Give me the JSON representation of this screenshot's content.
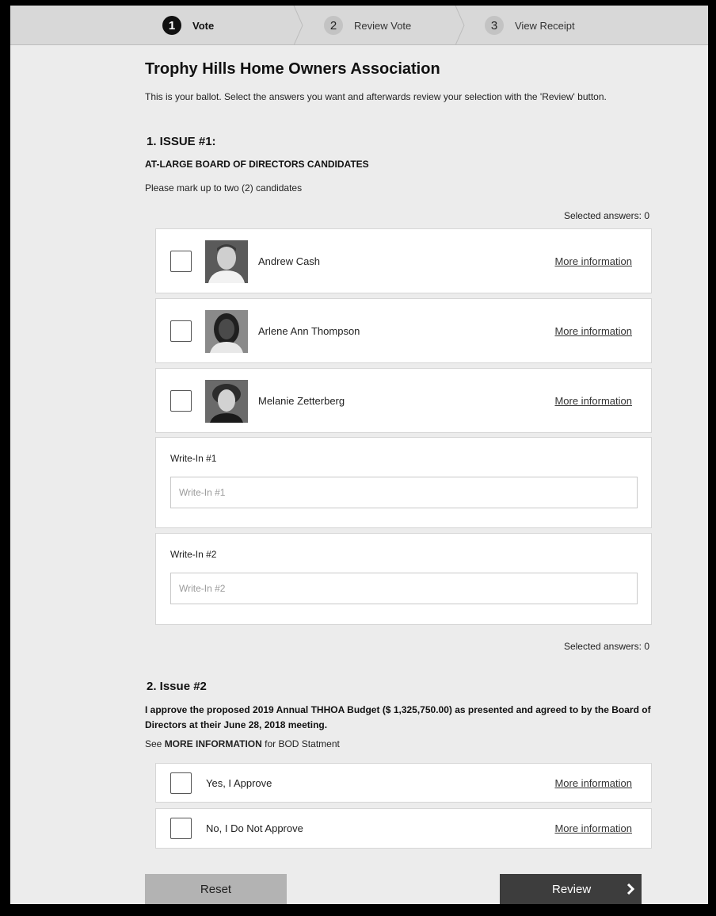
{
  "stepper": [
    {
      "num": "1",
      "label": "Vote"
    },
    {
      "num": "2",
      "label": "Review Vote"
    },
    {
      "num": "3",
      "label": "View Receipt"
    }
  ],
  "ballot": {
    "title": "Trophy Hills Home Owners Association",
    "intro": "This is your ballot. Select the answers you want and afterwards review your selection with the 'Review' button."
  },
  "issue1": {
    "heading": "1. ISSUE #1:",
    "subheading": "AT-LARGE BOARD OF DIRECTORS CANDIDATES",
    "instruction": "Please mark up to two (2) candidates",
    "selected_top": "Selected answers: 0",
    "selected_bottom": "Selected answers: 0",
    "candidates": [
      {
        "name": "Andrew Cash",
        "link": "More information"
      },
      {
        "name": "Arlene Ann Thompson",
        "link": "More information"
      },
      {
        "name": "Melanie Zetterberg",
        "link": "More information"
      }
    ],
    "write_ins": [
      {
        "label": "Write-In #1",
        "placeholder": "Write-In #1",
        "value": ""
      },
      {
        "label": "Write-In #2",
        "placeholder": "Write-In #2",
        "value": ""
      }
    ]
  },
  "issue2": {
    "heading": "2. Issue #2",
    "statement": "I approve the proposed 2019 Annual THHOA Budget ($ 1,325,750.00) as presented and agreed to by the Board of Directors at their June 28, 2018 meeting.",
    "see_prefix": "See ",
    "see_bold": "MORE INFORMATION",
    "see_suffix": " for BOD Statment",
    "options": [
      {
        "label": "Yes, I Approve",
        "link": "More information"
      },
      {
        "label": "No, I Do Not Approve",
        "link": "More information"
      }
    ]
  },
  "actions": {
    "reset_label": "Reset",
    "review_label": "Review"
  },
  "icons": {
    "review_arrow": "chevron-right-icon",
    "step_separator": "chevron-separator-icon"
  },
  "colors": {
    "active_step": "#111111",
    "review_button": "#3d3d3d",
    "reset_button": "#b3b3b3",
    "page_bg": "#ececec"
  }
}
